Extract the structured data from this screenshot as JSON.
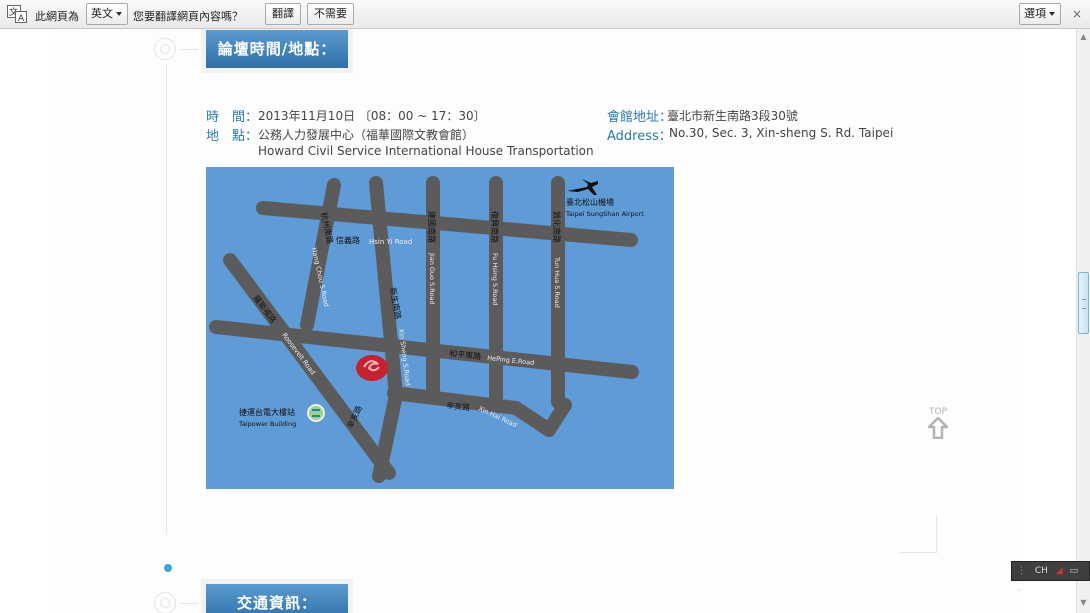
{
  "translate_bar": {
    "icon": "translate-icon",
    "prompt_prefix": "此網頁為",
    "language": "英文",
    "question": "您要翻譯網頁內容嗎？",
    "translate_label": "翻譯",
    "no_label": "不需要",
    "options_label": "選項",
    "close_glyph": "×"
  },
  "forum": {
    "title": "論壇時間/地點：",
    "time_label": "時　間：",
    "time_value": "2013年11月10日 〔08：00 ~ 17：30〕",
    "place_label": "地　點：",
    "place_value": "公務人力發展中心（福華國際文教會館）",
    "place_value_en": "Howard Civil Service International House Transportation",
    "address_label": "會館地址：",
    "address_value": "臺北市新生南路3段30號",
    "address_en_label": "Address：",
    "address_en_value": "No.30, Sec. 3, Xin-sheng S. Rd. Taipei"
  },
  "map": {
    "airport_zh": "臺北松山機場",
    "airport_en": "Taipei SungShan Airport",
    "hsinyi_zh": "信義路",
    "hsinyi_en": "Hsin Yi Road",
    "hangchou_zh": "杭州南路",
    "hangchou_en": "Hang Chou S.Road",
    "jianguo_zh": "建國南路",
    "jianguo_en": "Jian Guo S.Road",
    "fuhsing_zh": "復興南路",
    "fuhsing_en": "Fu Hsing S.Road",
    "tunhua_zh": "敦化南路",
    "tunhua_en": "Tun Hua S.Road",
    "roosevelt_zh": "羅斯福路",
    "roosevelt_en": "Roosevelt Road",
    "xinsheng_zh": "新生南路",
    "xinsheng_en": "Xin Sheng S.Road",
    "heping_zh": "和平東路",
    "heping_en": "HePing E.Road",
    "xinhai_zh": "辛亥路",
    "xinhai_en": "Xin Hai Road",
    "xinhai2_zh": "辛亥路",
    "station_zh": "捷運台電大樓站",
    "station_en": "Taipower Building",
    "colors": {
      "water": "#5f9bd6",
      "road": "#5b5b5b",
      "marker": "#c8202e"
    }
  },
  "top_link": {
    "label": "TOP",
    "icon": "arrow-up-icon"
  },
  "traffic": {
    "title": "交通資訊："
  },
  "ime": {
    "label": "CH"
  }
}
